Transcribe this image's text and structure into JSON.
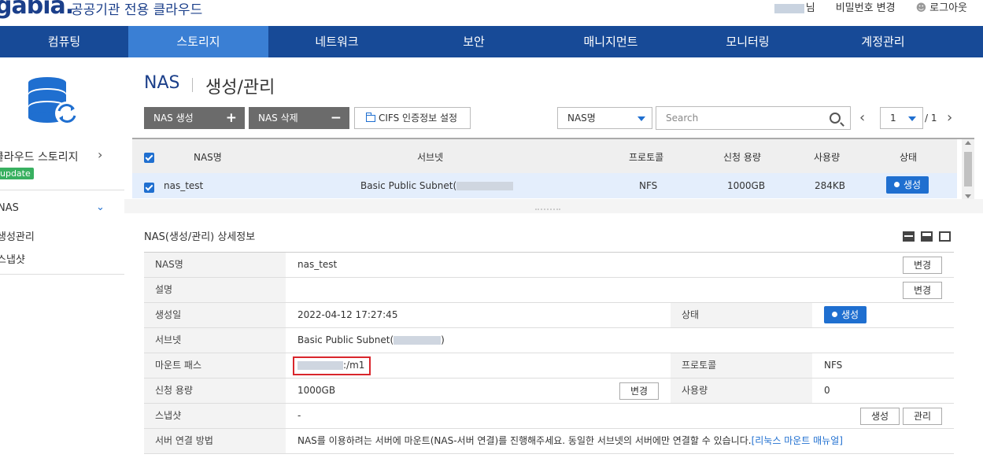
{
  "header": {
    "logo": "gabia.",
    "logo_sub": "공공기관 전용 클라우드",
    "user_suffix": "님",
    "change_password": "비밀번호 변경",
    "logout": "로그아웃",
    "user_icon": "person-icon"
  },
  "nav": {
    "items": [
      "컴퓨팅",
      "스토리지",
      "네트워크",
      "보안",
      "매니지먼트",
      "모니터링",
      "계정관리"
    ],
    "active": "스토리지"
  },
  "sidebar": {
    "icon": "database-sync-icon",
    "storage_label": "클라우드 스토리지",
    "update_badge": "update",
    "nas_label": "NAS",
    "sub_items": [
      "생성관리",
      "스냅샷"
    ]
  },
  "page": {
    "title": "NAS",
    "subtitle": "생성/관리"
  },
  "toolbar": {
    "create_label": "NAS 생성",
    "delete_label": "NAS 삭제",
    "cifs_label": "CIFS 인증정보 설정",
    "filter_selected": "NAS명",
    "search_placeholder": "Search",
    "page_current": "1",
    "page_total": "/ 1"
  },
  "list": {
    "columns": [
      "NAS명",
      "서브넷",
      "프로토콜",
      "신청 용량",
      "사용량",
      "상태"
    ],
    "rows": [
      {
        "name": "nas_test",
        "subnet": "Basic Public Subnet(",
        "protocol": "NFS",
        "capacity": "1000GB",
        "usage": "284KB",
        "status": "생성",
        "checked": true
      }
    ]
  },
  "detail": {
    "title": "NAS(생성/관리) 상세정보",
    "labels": {
      "name": "NAS명",
      "description": "설명",
      "created": "생성일",
      "status": "상태",
      "subnet": "서브넷",
      "mount_path": "마운트 패스",
      "protocol": "프로토콜",
      "capacity": "신청 용량",
      "usage": "사용량",
      "snapshot": "스냅샷",
      "connect": "서버 연결 방법"
    },
    "values": {
      "name": "nas_test",
      "description": "",
      "created": "2022-04-12 17:27:45",
      "status": "생성",
      "subnet_prefix": "Basic Public Subnet(",
      "subnet_suffix": ")",
      "mount_suffix": ":/m1",
      "protocol": "NFS",
      "capacity": "1000GB",
      "usage": "0",
      "snapshot": "-",
      "connect_text": "NAS를 이용하려는 서버에 마운트(NAS-서버 연결)를 진행해주세요. 동일한 서브넷의 서버에만 연결할 수 있습니다.",
      "connect_link": "[리눅스 마운트 매뉴얼]"
    },
    "buttons": {
      "change": "변경",
      "create": "생성",
      "manage": "관리"
    }
  },
  "colors": {
    "nav_bg": "#174a97",
    "nav_active": "#3a7fd4",
    "accent": "#1f6fd0",
    "badge_green": "#38b060",
    "highlight_red": "#d9262c"
  }
}
